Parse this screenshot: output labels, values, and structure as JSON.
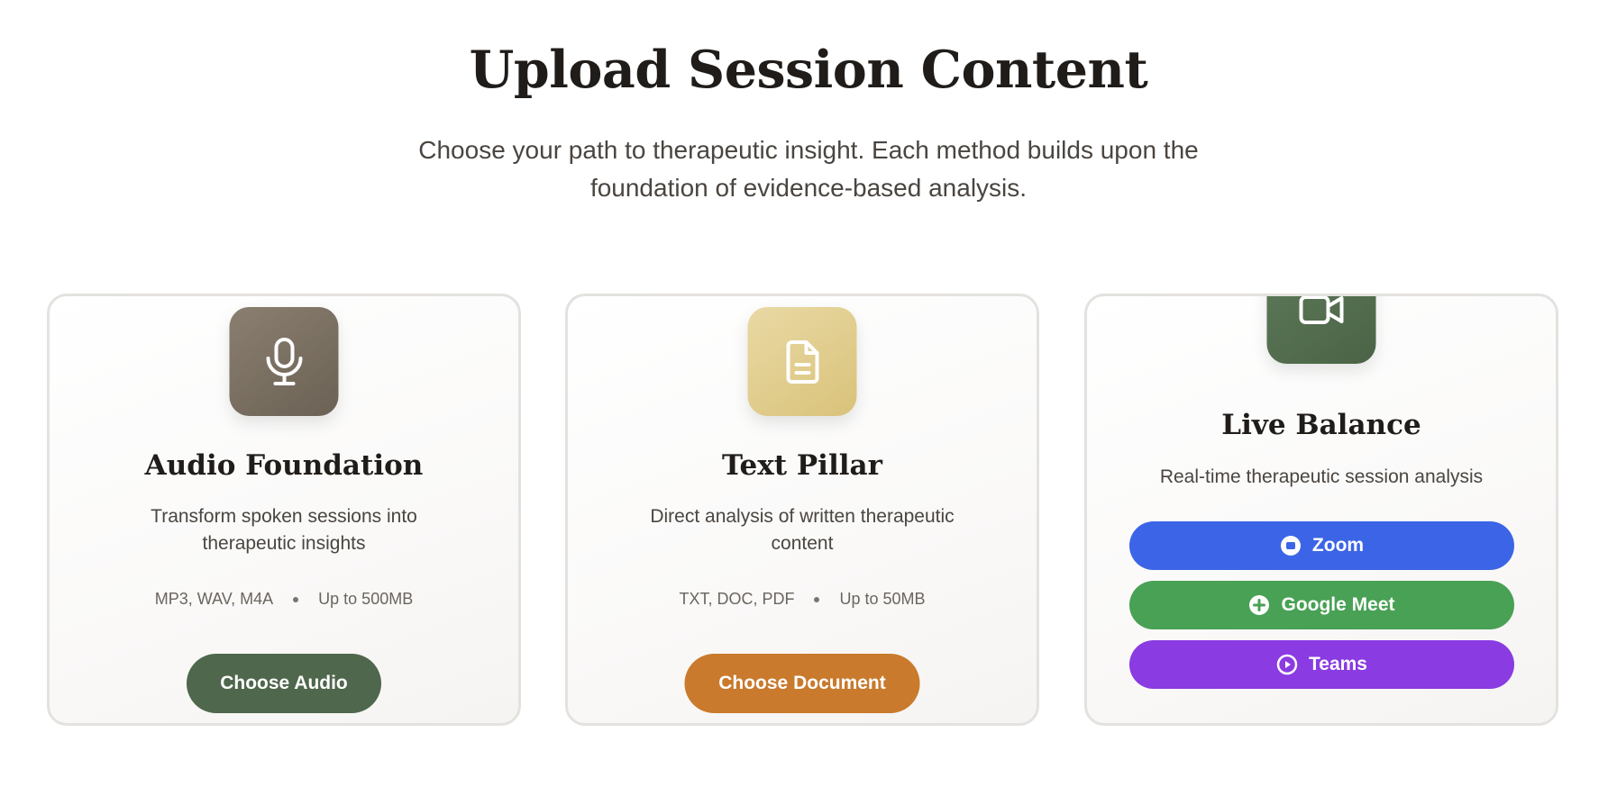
{
  "header": {
    "title": "Upload Session Content",
    "subtitle": "Choose your path to therapeutic insight. Each method builds upon the foundation of evidence-based analysis."
  },
  "cards": [
    {
      "icon": "microphone-icon",
      "title": "Audio Foundation",
      "description": "Transform spoken sessions into therapeutic insights",
      "formats": "MP3, WAV, M4A",
      "limit": "Up to 500MB",
      "button_label": "Choose Audio"
    },
    {
      "icon": "document-icon",
      "title": "Text Pillar",
      "description": "Direct analysis of written therapeutic content",
      "formats": "TXT, DOC, PDF",
      "limit": "Up to 50MB",
      "button_label": "Choose Document"
    },
    {
      "icon": "video-camera-icon",
      "title": "Live Balance",
      "description": "Real-time therapeutic session analysis",
      "options": [
        {
          "label": "Zoom",
          "icon": "stop-circle-icon",
          "color": "#3b65e6"
        },
        {
          "label": "Google Meet",
          "icon": "plus-circle-icon",
          "color": "#48a154"
        },
        {
          "label": "Teams",
          "icon": "play-circle-icon",
          "color": "#8a3be2"
        }
      ]
    }
  ],
  "colors": {
    "audio_tile": "#7a6f62",
    "text_tile": "#e1cd8f",
    "live_tile": "#55704f",
    "choose_audio": "#4f674c",
    "choose_document": "#c97a2c"
  }
}
